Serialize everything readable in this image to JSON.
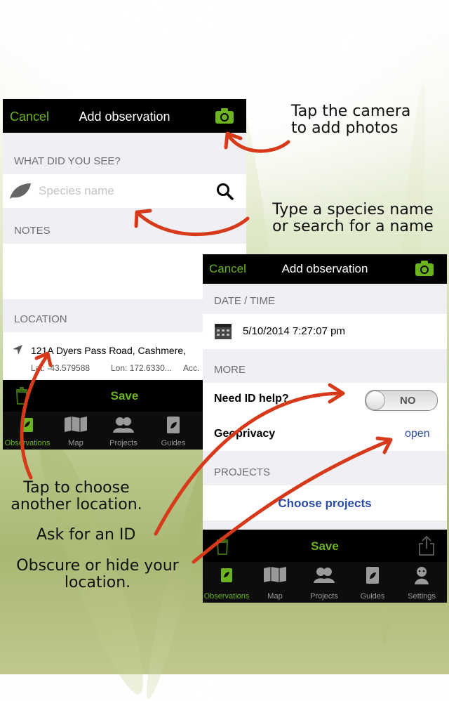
{
  "screen1": {
    "nav": {
      "cancel": "Cancel",
      "title": "Add observation"
    },
    "what_label": "WHAT DID YOU SEE?",
    "species_placeholder": "Species name",
    "notes_label": "NOTES",
    "location_label": "LOCATION",
    "address": "121A Dyers Pass Road, Cashmere,",
    "lat": "Lat: -43.579588",
    "lon": "Lon: 172.6330...",
    "acc": "Acc.",
    "save": "Save",
    "tabs": [
      {
        "label": "Observations",
        "active": true
      },
      {
        "label": "Map"
      },
      {
        "label": "Projects"
      },
      {
        "label": "Guides"
      }
    ]
  },
  "screen2": {
    "nav": {
      "cancel": "Cancel",
      "title": "Add observation"
    },
    "datetime_label": "DATE / TIME",
    "datetime": "5/10/2014 7:27:07 pm",
    "more_label": "MORE",
    "need_id_label": "Need ID help?",
    "toggle": "NO",
    "geoprivacy_label": "Geoprivacy",
    "geoprivacy_value": "open",
    "projects_label": "PROJECTS",
    "choose_projects": "Choose projects",
    "save": "Save",
    "tabs": [
      {
        "label": "Observations",
        "active": true
      },
      {
        "label": "Map"
      },
      {
        "label": "Projects"
      },
      {
        "label": "Guides"
      },
      {
        "label": "Settings"
      }
    ]
  },
  "annotations": {
    "camera": [
      "Tap the camera",
      "to add photos"
    ],
    "species": [
      "Type a species name",
      "or search for a name"
    ],
    "location": [
      "Tap to choose",
      "another location."
    ],
    "ask_id": "Ask for an ID",
    "obscure": [
      "Obscure or hide your",
      "location."
    ]
  },
  "colors": {
    "accent": "#6bb31f",
    "arrow": "#d63a1a",
    "link": "#2b4aa8"
  }
}
